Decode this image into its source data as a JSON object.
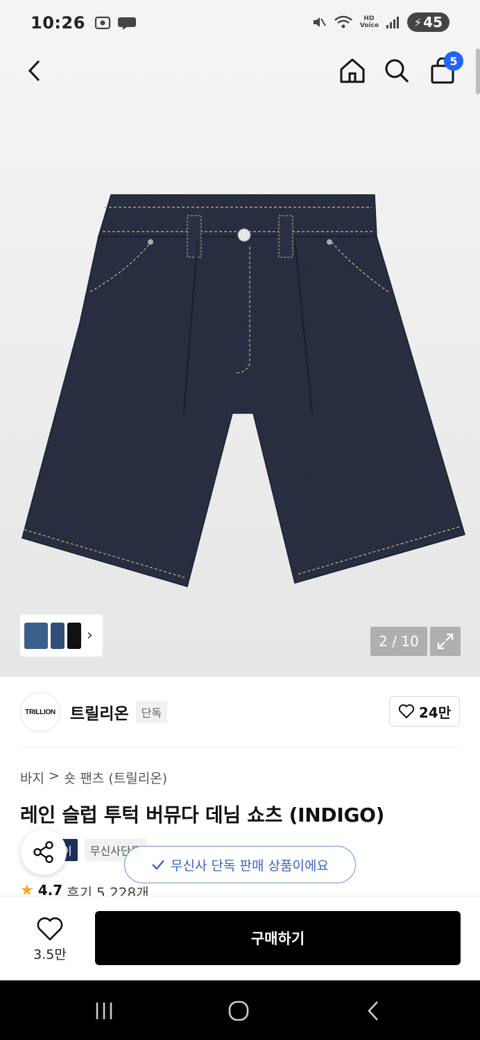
{
  "status_bar": {
    "time": "10:26",
    "battery": "45",
    "voice": "HD Voice"
  },
  "nav": {
    "back_icon": "chevron-left-icon",
    "home_icon": "home-icon",
    "search_icon": "search-icon",
    "cart_icon": "shopping-bag-icon",
    "cart_count": "5"
  },
  "gallery": {
    "counter": "2 / 10",
    "thumb_arrow": "›"
  },
  "brand": {
    "logo_text": "TRILLION",
    "name": "트릴리온",
    "tag": "단독",
    "likes": "24만"
  },
  "breadcrumb": {
    "category": "바지",
    "separator": ">",
    "subcategory": "숏 팬츠 (트릴리온)"
  },
  "product": {
    "title": "레인 슬럽 투턱 버뮤다 데님 쇼츠 (INDIGO)",
    "badge_dark": "이",
    "badge_light": "무신사단독",
    "tooltip": "무신사 단독 판매 상품이에요",
    "rating": "4.7",
    "review_label": "후기",
    "review_count": "5,228개"
  },
  "bottom_bar": {
    "wish_count": "3.5만",
    "buy_label": "구매하기"
  },
  "colors": {
    "accent_blue": "#1f64ff",
    "denim": "#262b3d",
    "badge_navy": "#1e2f5c",
    "tooltip_blue": "#3a64c2",
    "star": "#f5a623"
  }
}
